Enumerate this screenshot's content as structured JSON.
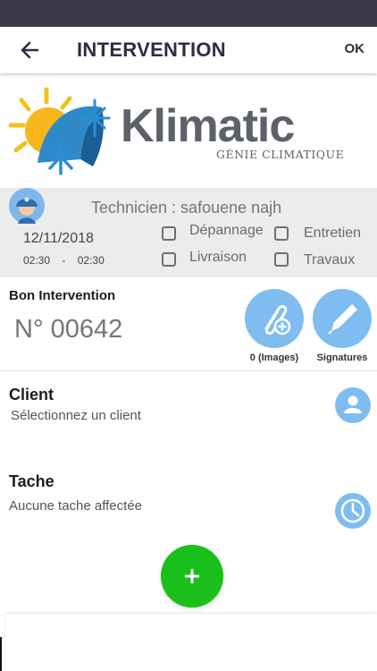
{
  "header": {
    "title": "INTERVENTION",
    "ok_label": "OK"
  },
  "logo": {
    "brand": "Klimatic",
    "tagline": "GÉNIE CLIMATIQUE"
  },
  "technician": {
    "label": "Technicien : safouene najh",
    "date": "12/11/2018",
    "start_time": "02:30",
    "separator": "-",
    "end_time": "02:30"
  },
  "types": [
    {
      "label": "Dépannage",
      "checked": false
    },
    {
      "label": "Entretien",
      "checked": false
    },
    {
      "label": "Livraison",
      "checked": false
    },
    {
      "label": "Travaux",
      "checked": false
    }
  ],
  "bon": {
    "title": "Bon Intervention",
    "number": "N° 00642",
    "images_label": "0 (Images)",
    "signatures_label": "Signatures"
  },
  "client": {
    "title": "Client",
    "placeholder": "Sélectionnez un client"
  },
  "tache": {
    "title": "Tache",
    "placeholder": "Aucune tache affectée"
  },
  "colors": {
    "accent_blue": "#7fbdf0",
    "fab_green": "#1bbf1b",
    "header_text": "#2e2e42",
    "status_bar": "#3b3a4c"
  },
  "icons": [
    "back-arrow-icon",
    "sun-snowflake-logo-icon",
    "technician-avatar-icon",
    "attach-image-icon",
    "pen-icon",
    "user-icon",
    "clock-icon",
    "plus-icon"
  ]
}
